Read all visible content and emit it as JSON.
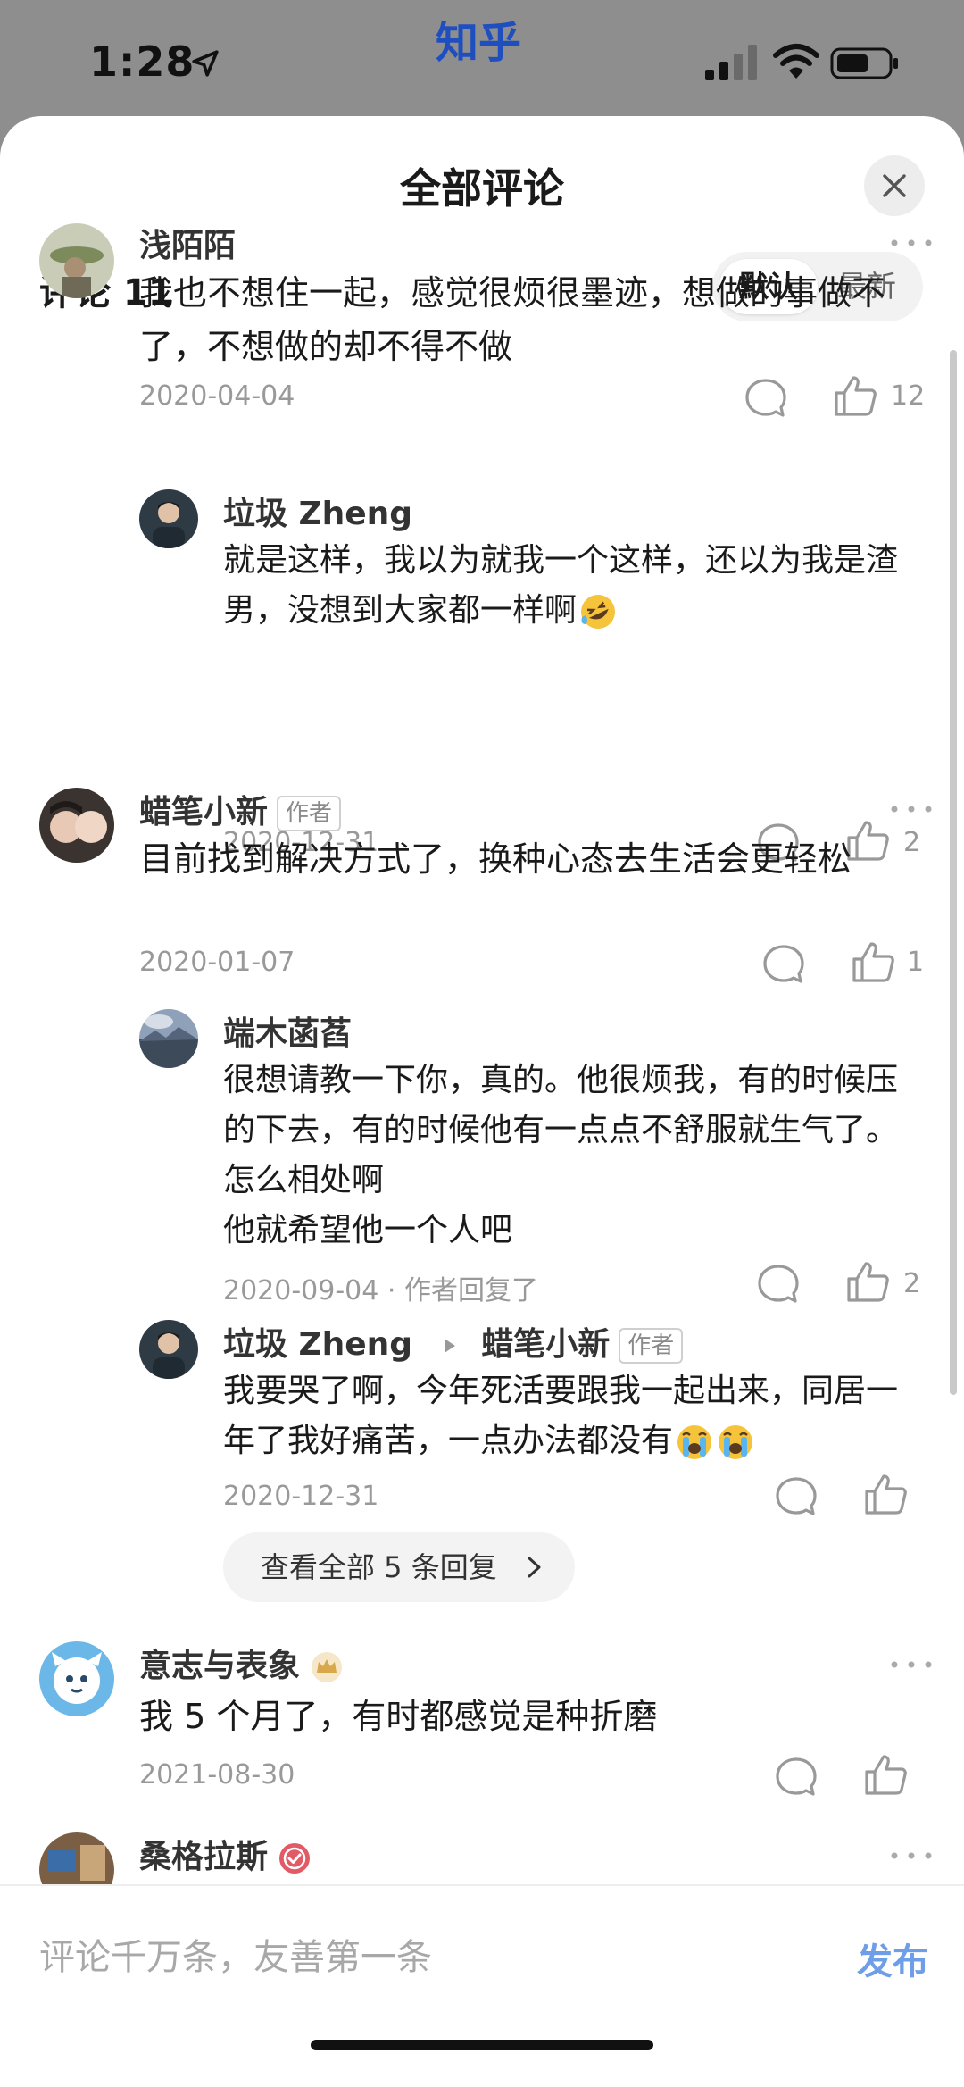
{
  "status_bar": {
    "time": "1:28",
    "app_name": "知乎"
  },
  "sheet": {
    "title": "全部评论",
    "count_label": "评论 11",
    "sort": {
      "default_label": "默认",
      "newest_label": "最新",
      "selected": "默认"
    }
  },
  "comments": [
    {
      "name": "浅陌陌",
      "text": "我也不想住一起，感觉很烦很墨迹，想做的事做不了，不想做的却不得不做",
      "date": "2020-04-04",
      "likes": "12",
      "replies": [
        {
          "name": "垃圾 Zheng",
          "text": "就是这样，我以为就我一个这样，还以为我是渣男，没想到大家都一样啊",
          "emoji": "rolling-on-floor-laughing-emoji",
          "date": "2020-12-31",
          "likes": "2"
        }
      ]
    },
    {
      "name": "蜡笔小新",
      "badge": "作者",
      "text": "目前找到解决方式了，换种心态去生活会更轻松",
      "date": "2020-01-07",
      "likes": "1",
      "replies": [
        {
          "name": "端木菡萏",
          "text": "很想请教一下你，真的。他很烦我，有的时候压的下去，有的时候他有一点点不舒服就生气了。怎么相处啊",
          "text2": "他就希望他一个人吧",
          "date": "2020-09-04",
          "meta": "· 作者回复了",
          "likes": "2"
        },
        {
          "name": "垃圾 Zheng",
          "reply_to": "蜡笔小新",
          "reply_to_badge": "作者",
          "text": "我要哭了啊，今年死活要跟我一起出来，同居一年了我好痛苦，一点办法都没有",
          "emoji": "loudly-crying-emoji",
          "date": "2020-12-31",
          "likes": ""
        }
      ],
      "view_all_label": "查看全部 5 条回复"
    },
    {
      "name": "意志与表象",
      "text": "我 5 个月了，有时都感觉是种折磨",
      "date": "2021-08-30",
      "likes": ""
    },
    {
      "name": "桑格拉斯"
    }
  ],
  "input": {
    "placeholder": "评论千万条，友善第一条",
    "value": "",
    "publish_label": "发布"
  },
  "colors": {
    "accent": "#6e9ee8",
    "app_name": "#1f4fbf",
    "muted": "#999999"
  },
  "icons": [
    "location-arrow-icon",
    "signal-icon",
    "wifi-icon",
    "battery-icon",
    "close-icon",
    "more-icon",
    "comment-icon",
    "like-icon",
    "chevron-right-icon",
    "reply-arrow-icon",
    "crown-badge-icon",
    "verified-badge-icon"
  ]
}
